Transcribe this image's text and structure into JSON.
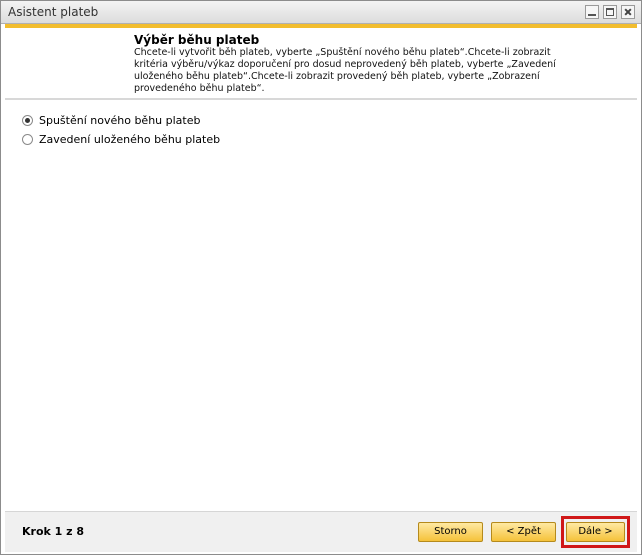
{
  "window": {
    "title": "Asistent plateb"
  },
  "header": {
    "title": "Výběr běhu plateb",
    "description": "Chcete-li vytvořit běh plateb, vyberte „Spuštění nového běhu plateb“.Chcete-li zobrazit kritéria výběru/výkaz doporučení pro dosud neprovedený běh plateb, vyberte „Zavedení uloženého běhu plateb“.Chcete-li zobrazit provedený běh plateb, vyberte „Zobrazení provedeného běhu plateb“."
  },
  "options": [
    {
      "label": "Spuštění nového běhu plateb",
      "selected": true
    },
    {
      "label": "Zavedení uloženého běhu plateb",
      "selected": false
    }
  ],
  "footer": {
    "step": "Krok 1 z 8",
    "cancel_label": "Storno",
    "back_label": "< Zpět",
    "next_label": "Dále >"
  },
  "colors": {
    "accent_bar": "#f2bd2e",
    "button": "#f5c23a",
    "highlight": "#d01818"
  }
}
